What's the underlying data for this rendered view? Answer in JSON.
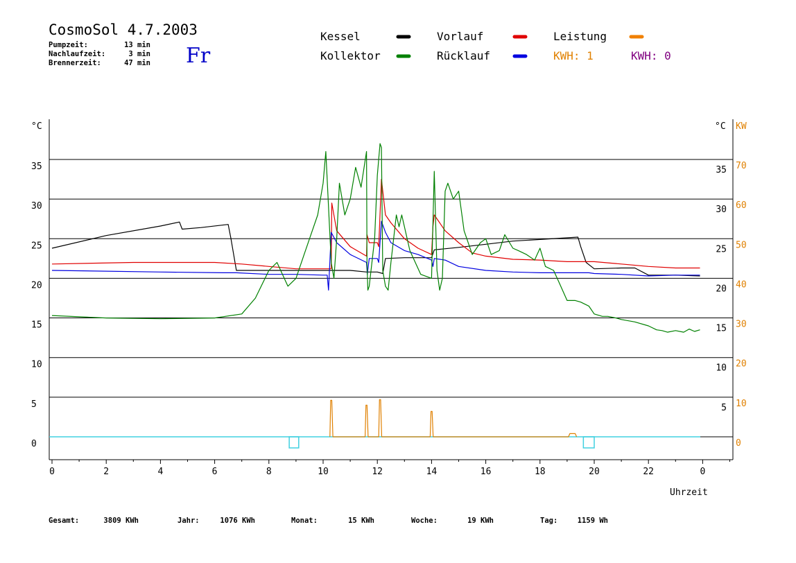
{
  "header": {
    "title": "CosmoSol 4.7.2003",
    "day": "Fr",
    "stats": [
      {
        "label": "Pumpzeit:",
        "value": "13 min"
      },
      {
        "label": "Nachlaufzeit:",
        "value": "3 min"
      },
      {
        "label": "Brennerzeit:",
        "value": "47 min"
      }
    ]
  },
  "legend": {
    "items": [
      {
        "name": "Kessel",
        "color": "#000000"
      },
      {
        "name": "Vorlauf",
        "color": "#e00000"
      },
      {
        "name": "Leistung",
        "color": "#f08000"
      },
      {
        "name": "Kollektor",
        "color": "#008000"
      },
      {
        "name": "Rücklauf",
        "color": "#0000e0"
      }
    ],
    "kwh": [
      {
        "text": "KWH: 1",
        "color": "#e08000"
      },
      {
        "text": "KWH: 0",
        "color": "#800080"
      }
    ]
  },
  "footer": {
    "items": [
      {
        "label": "Gesamt:",
        "value": "3809 KWh"
      },
      {
        "label": "Jahr:",
        "value": "1076 KWh"
      },
      {
        "label": "Monat:",
        "value": "15 KWh"
      },
      {
        "label": "Woche:",
        "value": "19 KWh"
      },
      {
        "label": "Tag:",
        "value": "1159 Wh"
      }
    ]
  },
  "chart_data": {
    "type": "line",
    "xlabel": "Uhrzeit",
    "ylabel_left": "°C",
    "ylabel_right": "°C",
    "ylabel_power": "KW",
    "xlim": [
      0,
      24
    ],
    "ylim": [
      -2.8,
      40
    ],
    "x_ticks": [
      "0",
      "2",
      "4",
      "6",
      "8",
      "10",
      "12",
      "14",
      "16",
      "18",
      "20",
      "22",
      "0"
    ],
    "y_ticks_left": [
      0,
      5,
      10,
      15,
      20,
      25,
      30,
      35
    ],
    "y_ticks_right": [
      5,
      10,
      15,
      20,
      25,
      30,
      35
    ],
    "y_ticks_power": [
      0,
      10,
      20,
      30,
      40,
      50,
      60,
      70
    ],
    "grid": "horizontal",
    "series": [
      {
        "name": "Kessel",
        "color": "#000000",
        "x": [
          0,
          2,
          4,
          4.7,
          4.8,
          5.5,
          6.5,
          6.6,
          6.8,
          8,
          9,
          10,
          10.3,
          11,
          11.6,
          11.7,
          12,
          12.2,
          12.3,
          13,
          14,
          14.1,
          15,
          16,
          17,
          18,
          19.4,
          19.5,
          19.7,
          20,
          21,
          21.5,
          22,
          23,
          23.9
        ],
        "y": [
          23.8,
          25.4,
          26.6,
          27.1,
          26.2,
          26.4,
          26.8,
          25,
          21,
          21,
          21,
          21,
          21,
          21,
          20.8,
          20.8,
          20.8,
          20.6,
          22.5,
          22.6,
          22.6,
          23.6,
          23.9,
          24.3,
          24.7,
          24.9,
          25.2,
          24,
          22,
          21.2,
          21.3,
          21.3,
          20.4,
          20.4,
          20.3
        ]
      },
      {
        "name": "Vorlauf",
        "color": "#e00000",
        "x": [
          0,
          3,
          6,
          7,
          8,
          9,
          10,
          10.3,
          10.32,
          10.5,
          11,
          11.6,
          11.62,
          11.7,
          12,
          12.05,
          12.15,
          12.3,
          12.5,
          13,
          13.5,
          14,
          14.05,
          14.1,
          14.5,
          15,
          15.5,
          16,
          17,
          18,
          19,
          20,
          21,
          22,
          23,
          23.9
        ],
        "y": [
          21.8,
          22,
          22,
          21.8,
          21.5,
          21.2,
          21.2,
          21.2,
          29.5,
          26,
          24,
          22.8,
          25.5,
          24.5,
          24.5,
          24,
          32.5,
          28,
          27,
          25,
          23.8,
          23,
          26.5,
          28,
          26,
          24.5,
          23.2,
          22.8,
          22.4,
          22.3,
          22.1,
          22.1,
          21.8,
          21.5,
          21.3,
          21.3
        ]
      },
      {
        "name": "Rücklauf",
        "color": "#0000e0",
        "x": [
          0,
          4,
          6.3,
          6.8,
          8,
          9,
          10,
          10.15,
          10.2,
          10.3,
          10.5,
          11,
          11.6,
          11.63,
          11.7,
          12,
          12.05,
          12.15,
          12.3,
          12.5,
          13,
          13.5,
          14,
          14.05,
          14.1,
          14.5,
          15,
          16,
          17,
          18,
          19,
          19.8,
          20,
          21,
          22,
          23,
          23.9
        ],
        "y": [
          21,
          20.8,
          20.7,
          20.7,
          20.5,
          20.5,
          20.4,
          20.4,
          18.5,
          25.8,
          24.5,
          23,
          22,
          20.5,
          22.5,
          22.5,
          22,
          27.2,
          25.8,
          24.5,
          23.5,
          23,
          22.3,
          21.5,
          22.5,
          22.3,
          21.5,
          21,
          20.8,
          20.7,
          20.7,
          20.7,
          20.6,
          20.5,
          20.3,
          20.4,
          20.4
        ]
      },
      {
        "name": "Kollektor",
        "color": "#008000",
        "x": [
          0,
          2,
          4,
          6,
          7,
          7.5,
          8,
          8.3,
          8.5,
          8.7,
          9,
          9.3,
          9.5,
          9.8,
          10,
          10.1,
          10.3,
          10.4,
          10.5,
          10.6,
          10.8,
          11,
          11.2,
          11.4,
          11.6,
          11.62,
          11.65,
          11.7,
          11.8,
          11.9,
          12,
          12.1,
          12.15,
          12.2,
          12.3,
          12.4,
          12.5,
          12.7,
          12.8,
          12.9,
          13.2,
          13.6,
          14,
          14.05,
          14.1,
          14.2,
          14.3,
          14.4,
          14.5,
          14.6,
          14.8,
          15,
          15.2,
          15.5,
          15.8,
          16,
          16.2,
          16.5,
          16.7,
          17,
          17.2,
          17.5,
          17.8,
          18,
          18.2,
          18.5,
          18.7,
          19,
          19.3,
          19.5,
          19.8,
          20,
          20.3,
          20.5,
          20.8,
          21,
          21.5,
          22,
          22.3,
          22.5,
          22.7,
          23,
          23.3,
          23.5,
          23.7,
          23.9
        ],
        "y": [
          15.3,
          15,
          14.9,
          15,
          15.5,
          17.5,
          21,
          22,
          20.5,
          19,
          20,
          23,
          25,
          28,
          32,
          36,
          22,
          20,
          25,
          32,
          28,
          30,
          34,
          31.5,
          36,
          22,
          18.5,
          19,
          22,
          25,
          33,
          37,
          36.5,
          21,
          19,
          18.5,
          22,
          28,
          26.5,
          28,
          23.5,
          20.5,
          20,
          27,
          33.5,
          21,
          18.5,
          20,
          31,
          32,
          30,
          31,
          26,
          23,
          24.5,
          25,
          23,
          23.5,
          25.5,
          23.8,
          23.5,
          23,
          22.3,
          23.8,
          21.5,
          21,
          19.5,
          17.2,
          17.2,
          17,
          16.5,
          15.5,
          15.2,
          15.2,
          15,
          14.8,
          14.5,
          14,
          13.5,
          13.4,
          13.2,
          13.4,
          13.2,
          13.6,
          13.3,
          13.5
        ]
      },
      {
        "name": "Leistung",
        "color": "#e08000",
        "x": [
          10.25,
          10.28,
          10.32,
          10.36,
          11.55,
          11.58,
          11.62,
          11.66,
          12.05,
          12.08,
          12.12,
          12.16,
          13.95,
          13.98,
          14.02,
          14.06,
          19.05,
          19.1,
          19.3,
          19.35
        ],
        "y": [
          0,
          4.6,
          4.6,
          0,
          0,
          4,
          4,
          0,
          0,
          4.7,
          4.7,
          0,
          0,
          3.2,
          3.2,
          0,
          0,
          0.4,
          0.4,
          0
        ]
      }
    ]
  }
}
